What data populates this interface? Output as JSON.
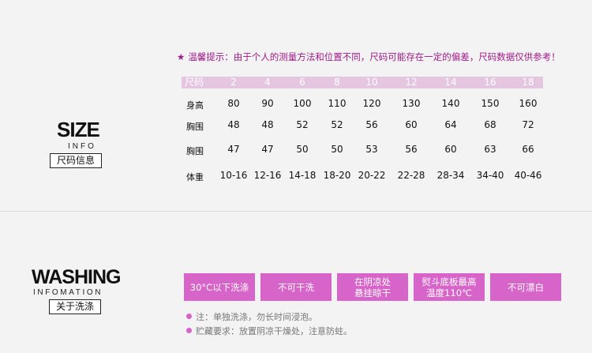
{
  "size": {
    "title": "SIZE",
    "subtitle": "INFO",
    "box_label": "尺码信息",
    "tip": "温馨提示：由于个人的测量方法和位置不同，尺码可能存在一定的偏差，尺码数据仅供参考！",
    "header": [
      "尺码",
      "2",
      "4",
      "6",
      "8",
      "10",
      "12",
      "14",
      "16",
      "18"
    ],
    "rows": [
      {
        "label": "身高",
        "values": [
          "80",
          "90",
          "100",
          "110",
          "120",
          "130",
          "140",
          "150",
          "160"
        ]
      },
      {
        "label": "胸围",
        "values": [
          "48",
          "48",
          "52",
          "52",
          "56",
          "60",
          "64",
          "68",
          "72"
        ]
      },
      {
        "label": "胸围",
        "values": [
          "47",
          "47",
          "50",
          "50",
          "53",
          "56",
          "60",
          "63",
          "66"
        ]
      },
      {
        "label": "体重",
        "values": [
          "10-16",
          "12-16",
          "14-18",
          "18-20",
          "20-22",
          "22-28",
          "28-34",
          "34-40",
          "40-46"
        ]
      }
    ]
  },
  "washing": {
    "title": "WASHING",
    "subtitle": "INFOMATION",
    "box_label": "关于洗涤",
    "buttons": [
      "30°C以下洗涤",
      "不可干洗",
      "在阴凉处\n悬挂晾干",
      "熨斗底板最高\n温度110℃",
      "不可漂白"
    ],
    "notes": [
      "注：单独洗涤，勿长时间浸泡。",
      "贮藏要求：放置阴凉干燥处，注意防蛀。"
    ]
  },
  "colors": {
    "accent": "#d765c9",
    "tip": "#a0198a",
    "header_bg": "#e5c6e0",
    "background": "#f4f3f4"
  }
}
